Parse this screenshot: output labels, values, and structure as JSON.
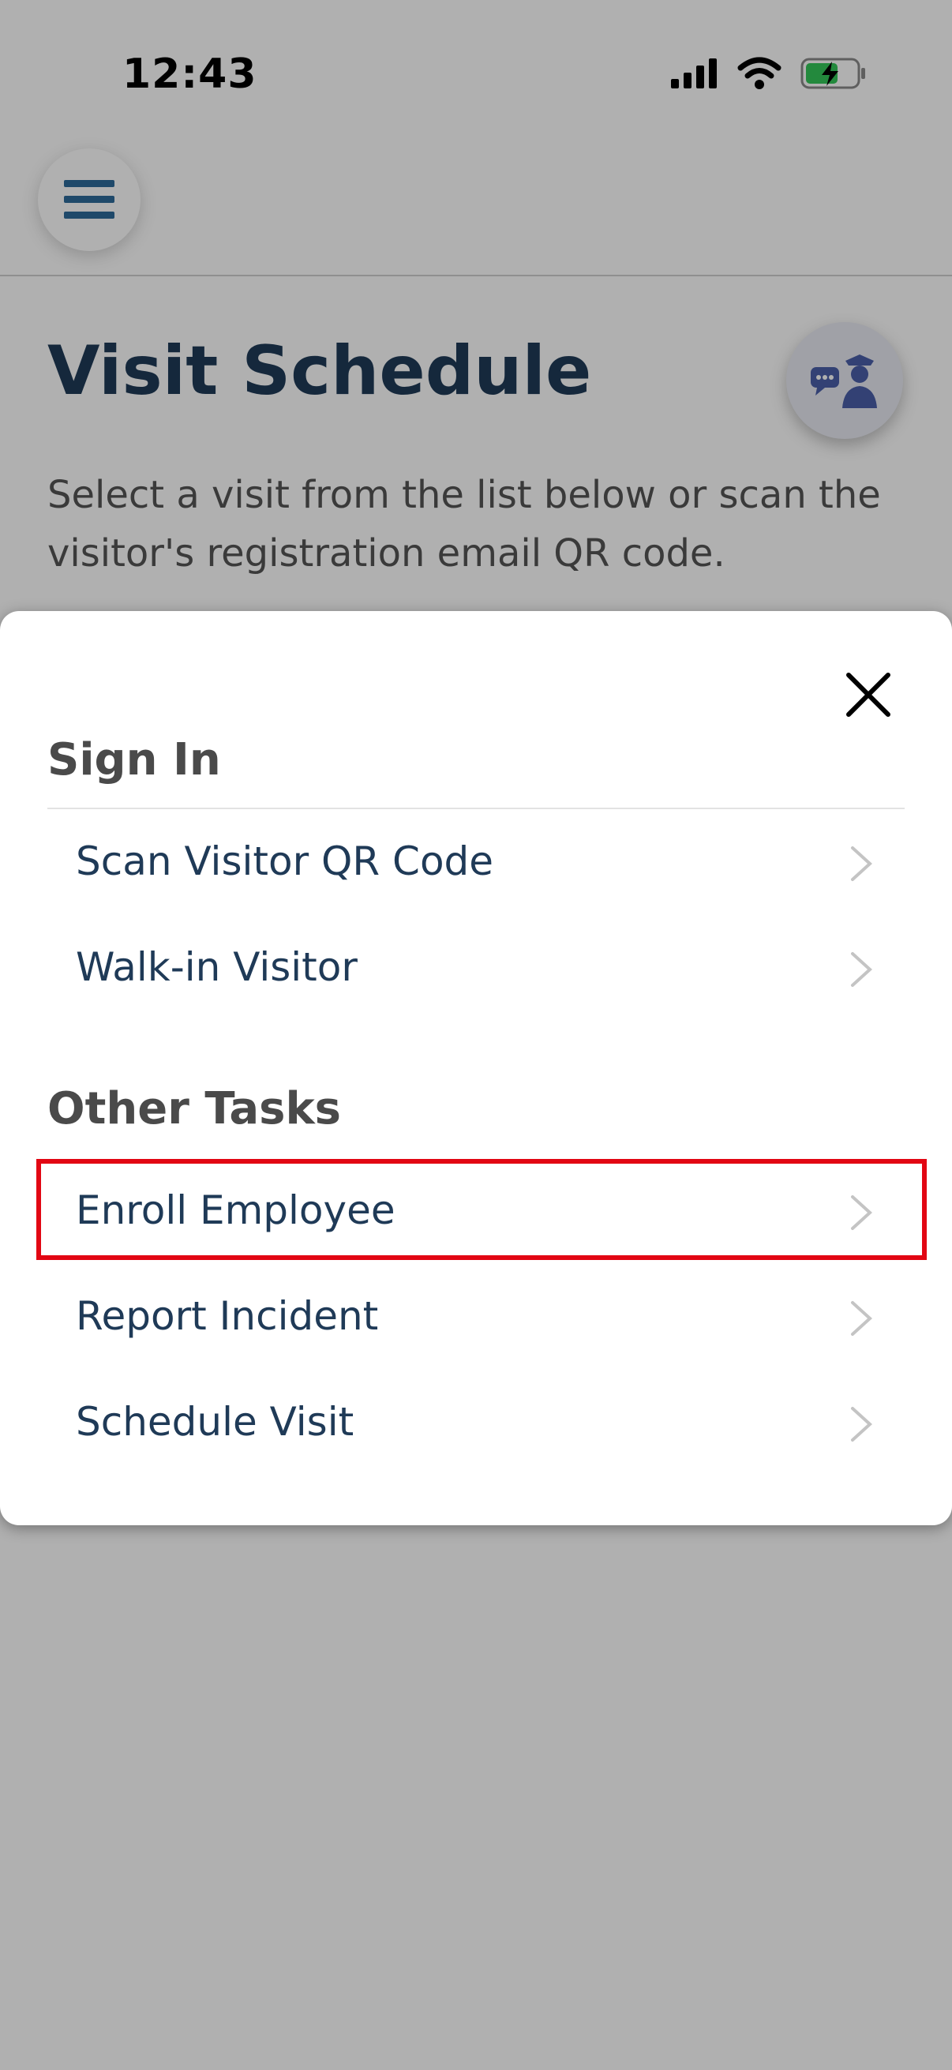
{
  "status_bar": {
    "time": "12:43"
  },
  "header": {
    "title": "Visit Schedule",
    "description": "Select a visit from the list below or scan the visitor's registration email QR code."
  },
  "sheet": {
    "sections": [
      {
        "title": "Sign In",
        "items": [
          {
            "label": "Scan Visitor QR Code"
          },
          {
            "label": "Walk-in Visitor"
          }
        ]
      },
      {
        "title": "Other Tasks",
        "items": [
          {
            "label": "Enroll Employee"
          },
          {
            "label": "Report Incident"
          },
          {
            "label": "Schedule Visit"
          }
        ]
      }
    ]
  },
  "colors": {
    "primary_text": "#1f3a57",
    "section_text": "#4a4a4a",
    "menu_icon": "#2e6a9a",
    "guard_icon": "#4a5fa8",
    "highlight": "#e20613",
    "battery_fill": "#34c759"
  },
  "icons": [
    "hamburger-menu-icon",
    "guard-chat-icon",
    "close-icon",
    "chevron-right-icon",
    "cellular-signal-icon",
    "wifi-icon",
    "battery-charging-icon"
  ]
}
